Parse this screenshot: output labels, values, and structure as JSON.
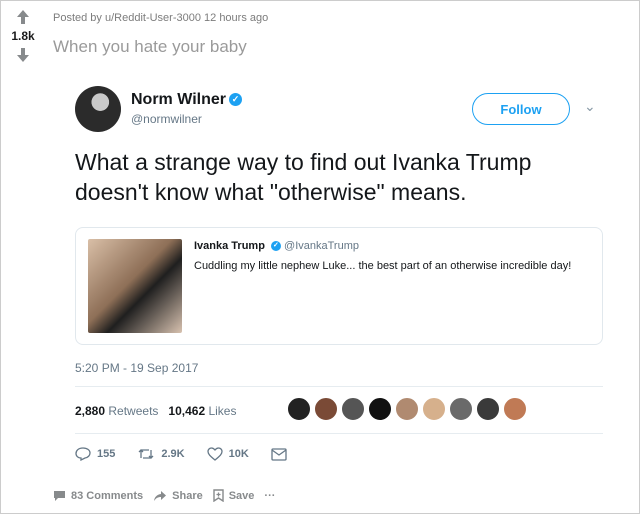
{
  "post": {
    "meta": "Posted by u/Reddit-User-3000 12 hours ago",
    "title": "When you hate your baby",
    "score": "1.8k"
  },
  "tweet": {
    "name": "Norm Wilner",
    "handle": "@normwilner",
    "follow_label": "Follow",
    "text": "What a strange way to find out Ivanka Trump doesn't know what \"otherwise\" means.",
    "quoted": {
      "name": "Ivanka Trump",
      "handle": "@IvankaTrump",
      "text": "Cuddling my little nephew Luke... the best part of an otherwise incredible day!"
    },
    "timestamp": "5:20 PM - 19 Sep 2017",
    "retweets_count": "2,880",
    "retweets_label": "Retweets",
    "likes_count": "10,462",
    "likes_label": "Likes",
    "actions": {
      "replies": "155",
      "retweets": "2.9K",
      "likes": "10K"
    }
  },
  "footer": {
    "comments": "83 Comments",
    "share": "Share",
    "save": "Save",
    "more": "···"
  },
  "colors": {
    "twitter_blue": "#1da1f2",
    "text_gray": "#657786"
  }
}
